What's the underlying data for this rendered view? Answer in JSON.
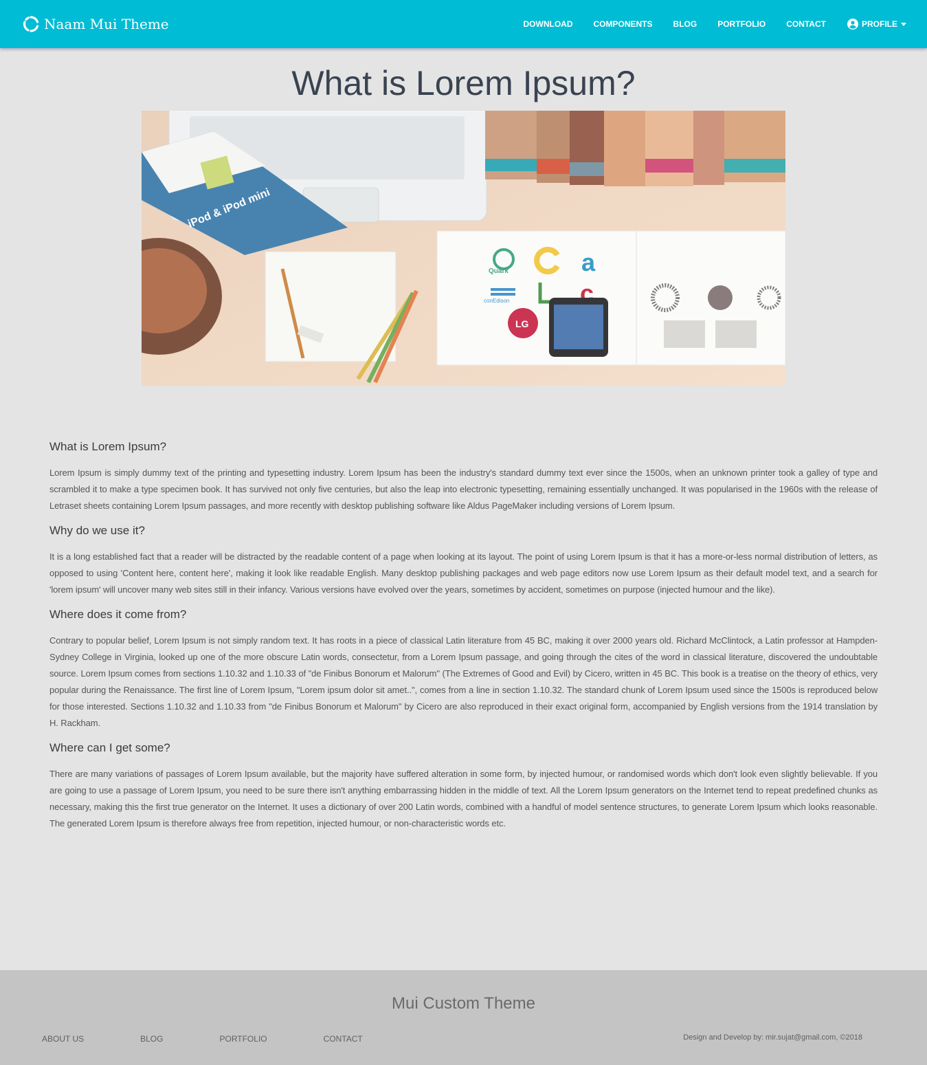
{
  "header": {
    "brand": "Naam Mui Theme",
    "nav": [
      "DOWNLOAD",
      "COMPONENTS",
      "BLOG",
      "PORTFOLIO",
      "CONTACT"
    ],
    "profile_label": "PROFILE"
  },
  "hero": {
    "title": "What is Lorem Ipsum?"
  },
  "sections": [
    {
      "heading": "What is Lorem Ipsum?",
      "body": "Lorem Ipsum is simply dummy text of the printing and typesetting industry. Lorem Ipsum has been the industry's standard dummy text ever since the 1500s, when an unknown printer took a galley of type and scrambled it to make a type specimen book. It has survived not only five centuries, but also the leap into electronic typesetting, remaining essentially unchanged. It was popularised in the 1960s with the release of Letraset sheets containing Lorem Ipsum passages, and more recently with desktop publishing software like Aldus PageMaker including versions of Lorem Ipsum."
    },
    {
      "heading": "Why do we use it?",
      "body": "It is a long established fact that a reader will be distracted by the readable content of a page when looking at its layout. The point of using Lorem Ipsum is that it has a more-or-less normal distribution of letters, as opposed to using 'Content here, content here', making it look like readable English. Many desktop publishing packages and web page editors now use Lorem Ipsum as their default model text, and a search for 'lorem ipsum' will uncover many web sites still in their infancy. Various versions have evolved over the years, sometimes by accident, sometimes on purpose (injected humour and the like)."
    },
    {
      "heading": "Where does it come from?",
      "body": "Contrary to popular belief, Lorem Ipsum is not simply random text. It has roots in a piece of classical Latin literature from 45 BC, making it over 2000 years old. Richard McClintock, a Latin professor at Hampden-Sydney College in Virginia, looked up one of the more obscure Latin words, consectetur, from a Lorem Ipsum passage, and going through the cites of the word in classical literature, discovered the undoubtable source. Lorem Ipsum comes from sections 1.10.32 and 1.10.33 of \"de Finibus Bonorum et Malorum\" (The Extremes of Good and Evil) by Cicero, written in 45 BC. This book is a treatise on the theory of ethics, very popular during the Renaissance. The first line of Lorem Ipsum, \"Lorem ipsum dolor sit amet..\", comes from a line in section 1.10.32. The standard chunk of Lorem Ipsum used since the 1500s is reproduced below for those interested. Sections 1.10.32 and 1.10.33 from \"de Finibus Bonorum et Malorum\" by Cicero are also reproduced in their exact original form, accompanied by English versions from the 1914 translation by H. Rackham."
    },
    {
      "heading": "Where can I get some?",
      "body": "There are many variations of passages of Lorem Ipsum available, but the majority have suffered alteration in some form, by injected humour, or randomised words which don't look even slightly believable. If you are going to use a passage of Lorem Ipsum, you need to be sure there isn't anything embarrassing hidden in the middle of text. All the Lorem Ipsum generators on the Internet tend to repeat predefined chunks as necessary, making this the first true generator on the Internet. It uses a dictionary of over 200 Latin words, combined with a handful of model sentence structures, to generate Lorem Ipsum which looks reasonable. The generated Lorem Ipsum is therefore always free from repetition, injected humour, or non-characteristic words etc."
    }
  ],
  "hero_image_labels": {
    "ipod": "iPod & iPod mini",
    "quark": "Quark",
    "conedison": "conEdison",
    "lg": "LG"
  },
  "footer": {
    "title": "Mui Custom Theme",
    "links": [
      "ABOUT US",
      "BLOG",
      "PORTFOLIO",
      "CONTACT"
    ],
    "credit": "Design and Develop by: mir.sujat@gmail.com, ©2018"
  },
  "colors": {
    "header_bg": "#00bcd4",
    "page_bg": "#e4e4e4",
    "footer_bg": "#c4c4c4"
  },
  "icons": [
    "brand-logo-icon",
    "account-circle-icon",
    "caret-down-icon"
  ]
}
